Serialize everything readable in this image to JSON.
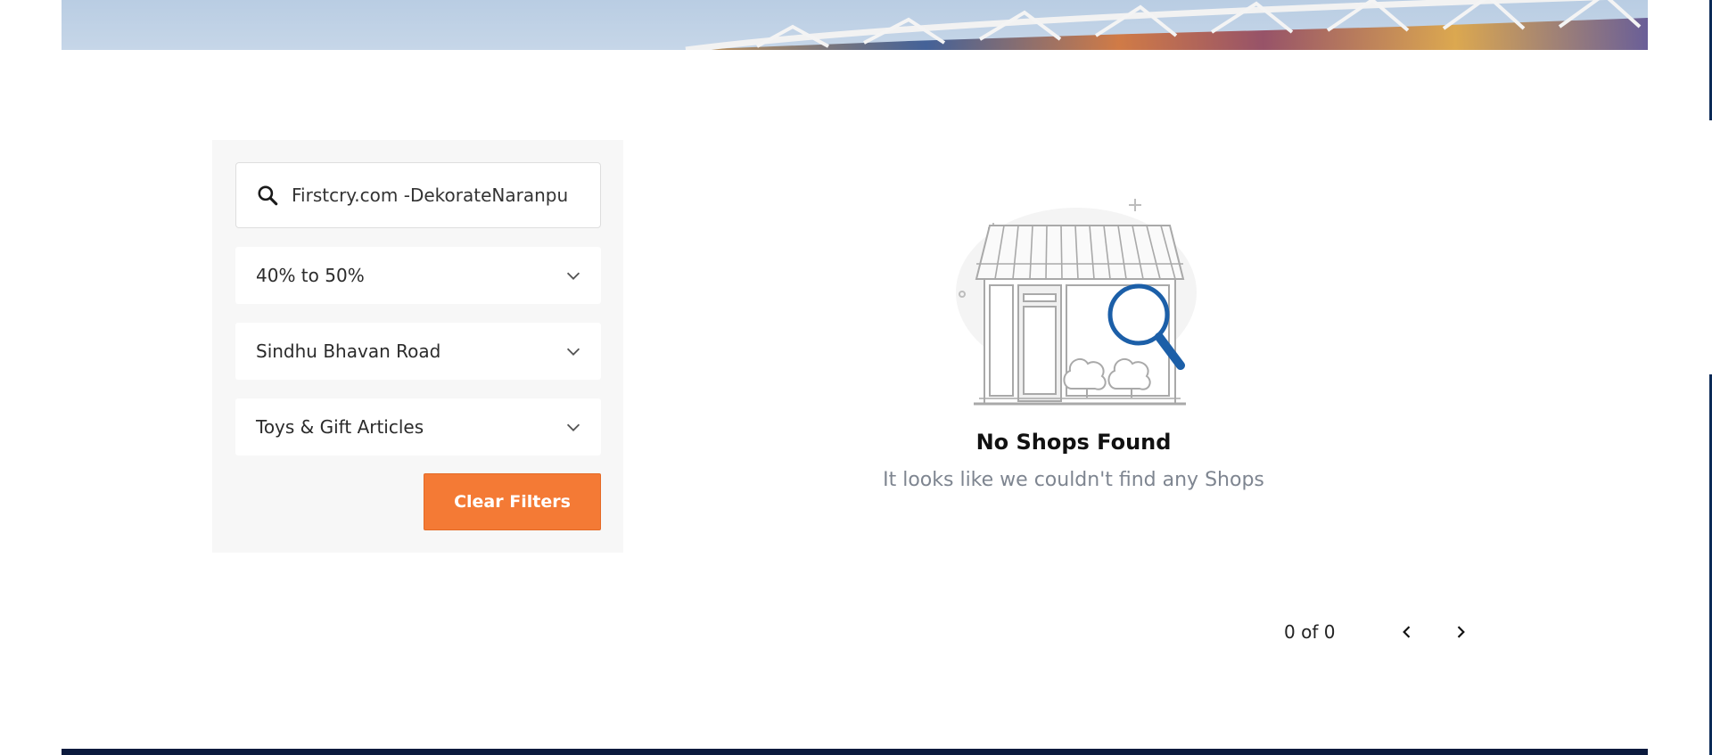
{
  "filters": {
    "search": {
      "value": "Firstcry.com -DekorateNaranpu",
      "icon": "search-icon"
    },
    "discount": {
      "label": "40% to 50%",
      "icon": "chevron-down-icon"
    },
    "area": {
      "label": "Sindhu Bhavan Road",
      "icon": "chevron-down-icon"
    },
    "category": {
      "label": "Toys & Gift Articles",
      "icon": "chevron-down-icon"
    },
    "clear_label": "Clear Filters"
  },
  "empty_state": {
    "title": "No Shops Found",
    "subtitle": "It looks like we couldn't find any Shops",
    "illustration": "shop-search-illustration"
  },
  "pagination": {
    "count_text": "0 of 0",
    "prev_icon": "chevron-left-icon",
    "next_icon": "chevron-right-icon"
  },
  "colors": {
    "accent": "#f47a35",
    "magnifier": "#1c5fa8",
    "footer": "#0b1a3d"
  }
}
